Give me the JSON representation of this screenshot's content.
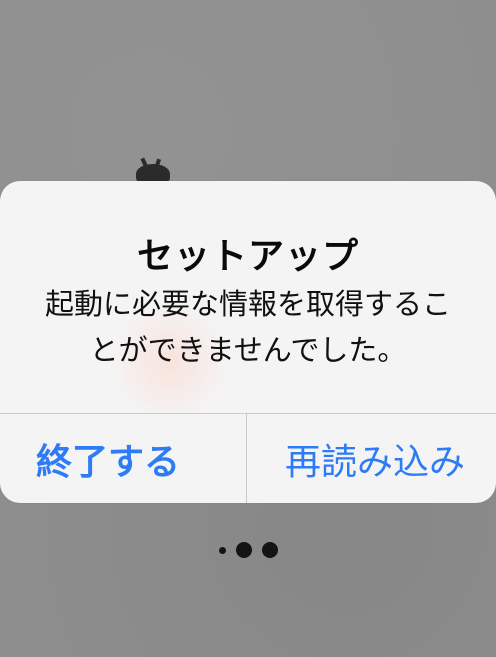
{
  "alert": {
    "title": "セットアップ",
    "message_line1": "起動に必要な情報を取得するこ",
    "message_line2": "とができませんでした。",
    "buttons": {
      "quit_label": "終了する",
      "reload_label": "再読み込み"
    }
  },
  "page_indicator": {
    "dots": 3
  },
  "colors": {
    "accent": "#2d7cf6",
    "background": "#8f8f8f",
    "alert_background": "#f4f4f4"
  }
}
